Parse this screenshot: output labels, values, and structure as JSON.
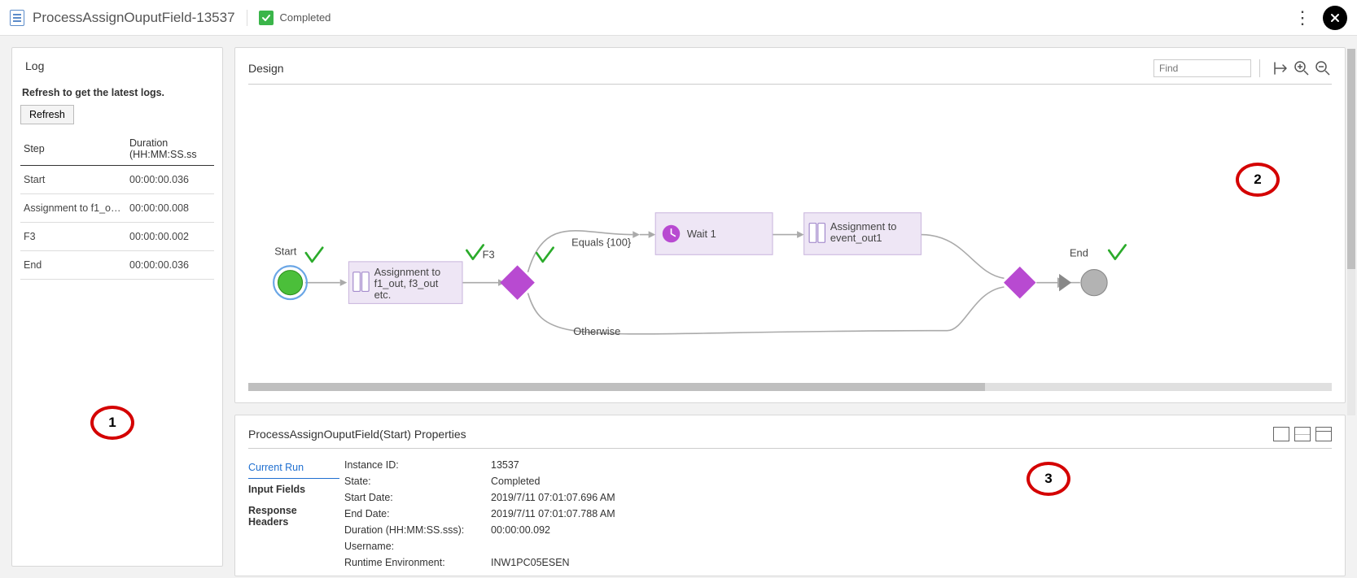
{
  "header": {
    "title": "ProcessAssignOuputField-13537",
    "status": "Completed"
  },
  "log": {
    "title": "Log",
    "help_text": "Refresh to get the latest logs.",
    "refresh_label": "Refresh",
    "col_step": "Step",
    "col_duration": "Duration (HH:MM:SS.ss",
    "rows": [
      {
        "step": "Start",
        "duration": "00:00:00.036"
      },
      {
        "step": "Assignment to f1_out, f...",
        "duration": "00:00:00.008"
      },
      {
        "step": "F3",
        "duration": "00:00:00.002"
      },
      {
        "step": "End",
        "duration": "00:00:00.036"
      }
    ]
  },
  "design": {
    "title": "Design",
    "find_placeholder": "Find",
    "nodes": {
      "start_label": "Start",
      "end_label": "End",
      "assign1_label_l1": "Assignment to",
      "assign1_label_l2": "f1_out, f3_out",
      "assign1_label_l3": "etc.",
      "branch_label": "F3",
      "equals_label": "Equals {100}",
      "otherwise_label": "Otherwise",
      "wait_label": "Wait 1",
      "assign2_label_l1": "Assignment to",
      "assign2_label_l2": "event_out1"
    }
  },
  "properties": {
    "title": "ProcessAssignOuputField(Start) Properties",
    "tabs": {
      "current_run": "Current Run",
      "input_fields": "Input Fields",
      "response_headers": "Response Headers"
    },
    "fields": {
      "instance_id_k": "Instance ID:",
      "instance_id_v": "13537",
      "state_k": "State:",
      "state_v": "Completed",
      "start_date_k": "Start Date:",
      "start_date_v": "2019/7/11 07:01:07.696 AM",
      "end_date_k": "End Date:",
      "end_date_v": "2019/7/11 07:01:07.788 AM",
      "duration_k": "Duration (HH:MM:SS.sss):",
      "duration_v": "00:00:00.092",
      "username_k": "Username:",
      "username_v": "",
      "runtime_env_k": "Runtime Environment:",
      "runtime_env_v": "INW1PC05ESEN"
    }
  },
  "callouts": {
    "c1": "1",
    "c2": "2",
    "c3": "3"
  }
}
